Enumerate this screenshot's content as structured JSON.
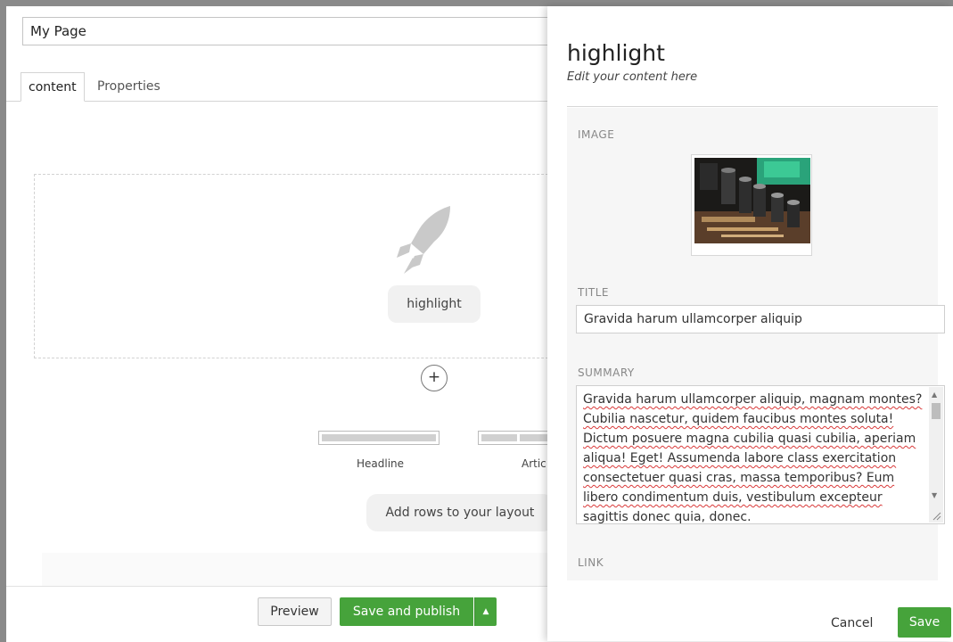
{
  "editor": {
    "page_name": "My Page",
    "tabs": [
      {
        "label": "content",
        "active": true
      },
      {
        "label": "Properties",
        "active": false
      }
    ],
    "grid": {
      "cell_label": "highlight",
      "cell_icon": "rocket-icon",
      "add_icon": "plus-icon",
      "layouts": [
        {
          "label": "Headline"
        },
        {
          "label": "Artic"
        }
      ],
      "add_rows_label": "Add rows to your layout"
    },
    "buttons": {
      "preview": "Preview",
      "save_and_publish": "Save and publish",
      "caret": "▲"
    }
  },
  "overlay": {
    "title": "highlight",
    "subtitle": "Edit your content here",
    "fields": {
      "image_label": "IMAGE",
      "title_label": "TITLE",
      "title_value": "Gravida harum ullamcorper aliquip",
      "summary_label": "SUMMARY",
      "summary_value": "Gravida harum ullamcorper aliquip, magnam montes? Cubilia nascetur, quidem faucibus montes soluta! Dictum posuere magna cubilia quasi cubilia, aperiam aliqua! Eget! Assumenda labore class exercitation consectetuer quasi cras, massa temporibus? Eum libero condimentum duis, vestibulum excepteur sagittis donec quia, donec.",
      "link_label": "LINK"
    },
    "buttons": {
      "cancel": "Cancel",
      "save": "Save"
    }
  },
  "colors": {
    "primary_green": "#46a33b",
    "backdrop_gray": "#8a8a8a"
  }
}
